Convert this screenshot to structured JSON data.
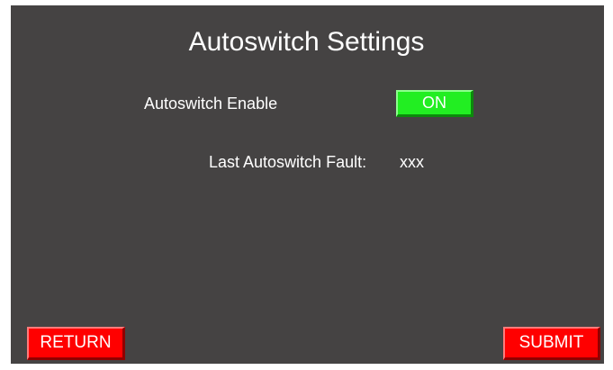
{
  "screen": {
    "title": "Autoswitch Settings",
    "background_color": "#454343"
  },
  "autoswitch": {
    "enable_label": "Autoswitch Enable",
    "enable_state": "ON",
    "enable_color": "#22ee22",
    "fault_label": "Last Autoswitch Fault:",
    "fault_value": "xxx"
  },
  "footer": {
    "return_label": "RETURN",
    "submit_label": "SUBMIT",
    "button_color": "#ff0000"
  }
}
